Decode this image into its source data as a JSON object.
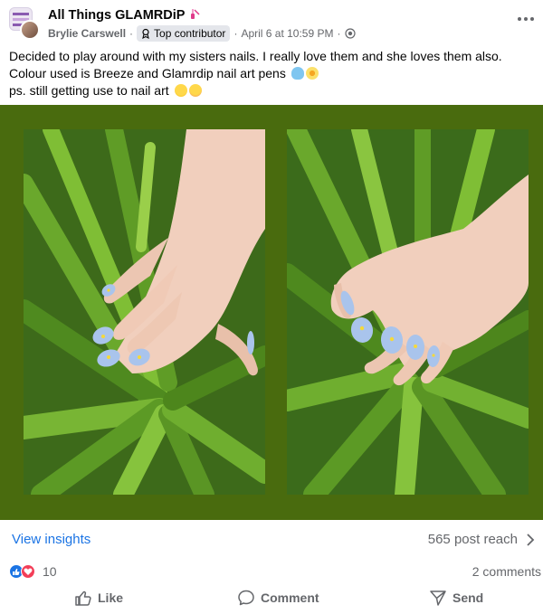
{
  "post": {
    "group_name": "All Things GLAMRDiP",
    "author": "Brylie Carswell",
    "badge": "Top contributor",
    "timestamp": "April 6 at 10:59 PM",
    "text_line1": "Decided to play around with my sisters nails. I really love them and she loves them also. Colour used is Breeze and Glamrdip nail art pens",
    "text_line2": "ps. still getting use to nail art",
    "icons": [
      "nail-polish-icon",
      "top-contributor-icon",
      "globe-icon",
      "more-options-icon"
    ]
  },
  "photos": [
    {
      "name": "left-hand-photo",
      "nail_color": "#a9c4ec",
      "accent": "#f5d93a"
    },
    {
      "name": "right-hand-photo",
      "nail_color": "#a9c4ec",
      "accent": "#f5d93a"
    }
  ],
  "colors": {
    "frame": "#496b0e",
    "accent_link": "#1b74e4",
    "muted": "#65676b"
  },
  "insights": {
    "link_label": "View insights",
    "reach": "565 post reach"
  },
  "reactions": {
    "count": "10",
    "comments": "2 comments"
  },
  "actions": {
    "like": "Like",
    "comment": "Comment",
    "send": "Send"
  }
}
